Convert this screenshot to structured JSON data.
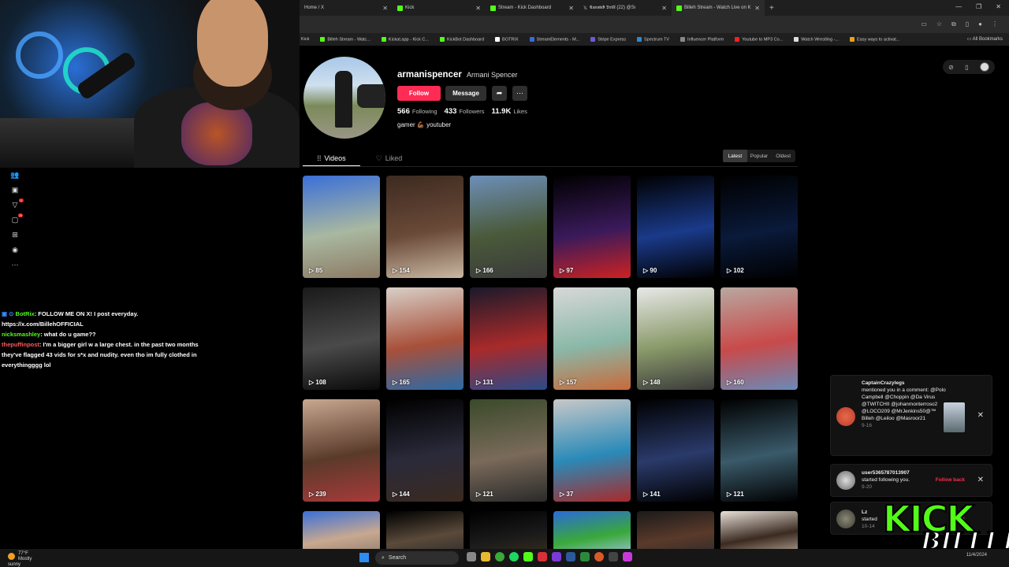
{
  "browser": {
    "tabs": [
      {
        "label": "Home / X",
        "active": false
      },
      {
        "label": "Kick",
        "active": false
      },
      {
        "label": "Stream - Kick Dashboard",
        "active": false
      },
      {
        "label": "𝕮𝖚𝖗𝖆𝖙𝖊𝖉 𝕯𝖗𝖎𝖑𝖑 (22) @Sı",
        "active": false
      },
      {
        "label": "Billeh Stream - Watch Live on K",
        "active": true
      }
    ],
    "bookmarks": [
      "Kick",
      "Billeh Stream - Watc...",
      "Kickat.app - Kick C...",
      "KickBot Dashboard",
      "BOTRIX",
      "StreamElements - M...",
      "Stripe Express",
      "Spectrum TV",
      "Influencer Platform",
      "Youtube to MP3 Co...",
      "Watch Wrestling -...",
      "Easy ways to activat..."
    ],
    "all_bookmarks": "All Bookmarks"
  },
  "profile": {
    "username": "armanispencer",
    "display_name": "Armani Spencer",
    "follow_label": "Follow",
    "message_label": "Message",
    "following_count": "566",
    "following_label": "Following",
    "followers_count": "433",
    "followers_label": "Followers",
    "likes_count": "11.9K",
    "likes_label": "Likes",
    "bio": "gamer 💪🏾 youtuber"
  },
  "video_tabs": {
    "videos": "Videos",
    "liked": "Liked"
  },
  "sort": {
    "latest": "Latest",
    "popular": "Popular",
    "oldest": "Oldest"
  },
  "videos": [
    {
      "views": "85",
      "colors": [
        "#3a6fd8",
        "#a9b8a0",
        "#8c7a64"
      ]
    },
    {
      "views": "154",
      "colors": [
        "#3d2a20",
        "#6a4a38",
        "#c9b8a2"
      ]
    },
    {
      "views": "166",
      "colors": [
        "#6d8fb8",
        "#4a5a3a",
        "#3a3a3a"
      ]
    },
    {
      "views": "97",
      "colors": [
        "#000000",
        "#3a1a5a",
        "#cc2222"
      ]
    },
    {
      "views": "90",
      "colors": [
        "#000000",
        "#1a3a8a",
        "#000000"
      ]
    },
    {
      "views": "102",
      "colors": [
        "#000000",
        "#0a1a3a",
        "#000000"
      ]
    },
    {
      "views": "108",
      "colors": [
        "#1a1a1a",
        "#4a4a4a",
        "#0a0a0a"
      ]
    },
    {
      "views": "165",
      "colors": [
        "#d8d0c8",
        "#a8503a",
        "#2a6aa8"
      ]
    },
    {
      "views": "131",
      "colors": [
        "#1a1a2a",
        "#a82a2a",
        "#2a4a8a"
      ]
    },
    {
      "views": "157",
      "colors": [
        "#d8d8d8",
        "#8ab8a8",
        "#c86a3a"
      ]
    },
    {
      "views": "148",
      "colors": [
        "#e8e8e8",
        "#8a9a6a",
        "#3a3a3a"
      ]
    },
    {
      "views": "160",
      "colors": [
        "#b8a8a0",
        "#c84a4a",
        "#6a8ab8"
      ]
    },
    {
      "views": "239",
      "colors": [
        "#c8a890",
        "#5a3a2a",
        "#a83a3a"
      ]
    },
    {
      "views": "144",
      "colors": [
        "#000000",
        "#2a2a3a",
        "#3a2a20"
      ]
    },
    {
      "views": "121",
      "colors": [
        "#3a4a2a",
        "#7a6a5a",
        "#2a2a2a"
      ]
    },
    {
      "views": "37",
      "colors": [
        "#c8c8c8",
        "#2a8ab8",
        "#a82a2a"
      ]
    },
    {
      "views": "141",
      "colors": [
        "#000000",
        "#2a3a6a",
        "#000000"
      ]
    },
    {
      "views": "121",
      "colors": [
        "#000000",
        "#3a5a6a",
        "#000000"
      ]
    },
    {
      "views": "",
      "colors": [
        "#3a6fd8",
        "#c8a890",
        "#8a7a6a"
      ]
    },
    {
      "views": "",
      "colors": [
        "#000000",
        "#5a4a3a",
        "#2a2a2a"
      ]
    },
    {
      "views": "",
      "colors": [
        "#000000",
        "#1a1a1a",
        "#3a3020"
      ]
    },
    {
      "views": "",
      "colors": [
        "#2a6ad8",
        "#3aa83a",
        "#a8c8e8"
      ]
    },
    {
      "views": "",
      "colors": [
        "#1a1a1a",
        "#5a3a2a",
        "#2a2a2a"
      ]
    },
    {
      "views": "",
      "colors": [
        "#e8e0d8",
        "#3a2a20",
        "#c8b8a8"
      ]
    }
  ],
  "chat": [
    {
      "user": "BotRix",
      "text": ": FOLLOW ME ON X! I post everyday. https://x.com/BillehOFFICIAL"
    },
    {
      "user": "nicksmashley",
      "text": ": what do u game??"
    },
    {
      "user": "thepuffinpost",
      "text": ": I'm a bigger girl w a large chest. in the past two months they've flagged 43 vids for s*x and nudity. even tho im fully clothed in everythingggg lol"
    }
  ],
  "chat_badges": {
    "filter": "11",
    "chat": "20"
  },
  "notifications": [
    {
      "user": "CaptainCrazylegs",
      "text": "mentioned you in a comment: @Polo Campbell @Choppin @Da Virus @TWITCHII @johanmonterroso2 @LOCO209 @MrJenkins50@™ Billeh @Leiloo @Masroor21",
      "date": "9-16"
    },
    {
      "user": "user5365787013907",
      "text": "started following you.",
      "date": "9-20",
      "action": "Follow back"
    },
    {
      "user": "Lz",
      "text": "started",
      "date": "10-14",
      "action": "back"
    }
  ],
  "overlay": {
    "kick": "KICK",
    "billeh": "BILLEH"
  },
  "taskbar": {
    "temp": "77°F",
    "condition": "Mostly sunny",
    "search_placeholder": "Search",
    "date": "11/4/2024"
  }
}
